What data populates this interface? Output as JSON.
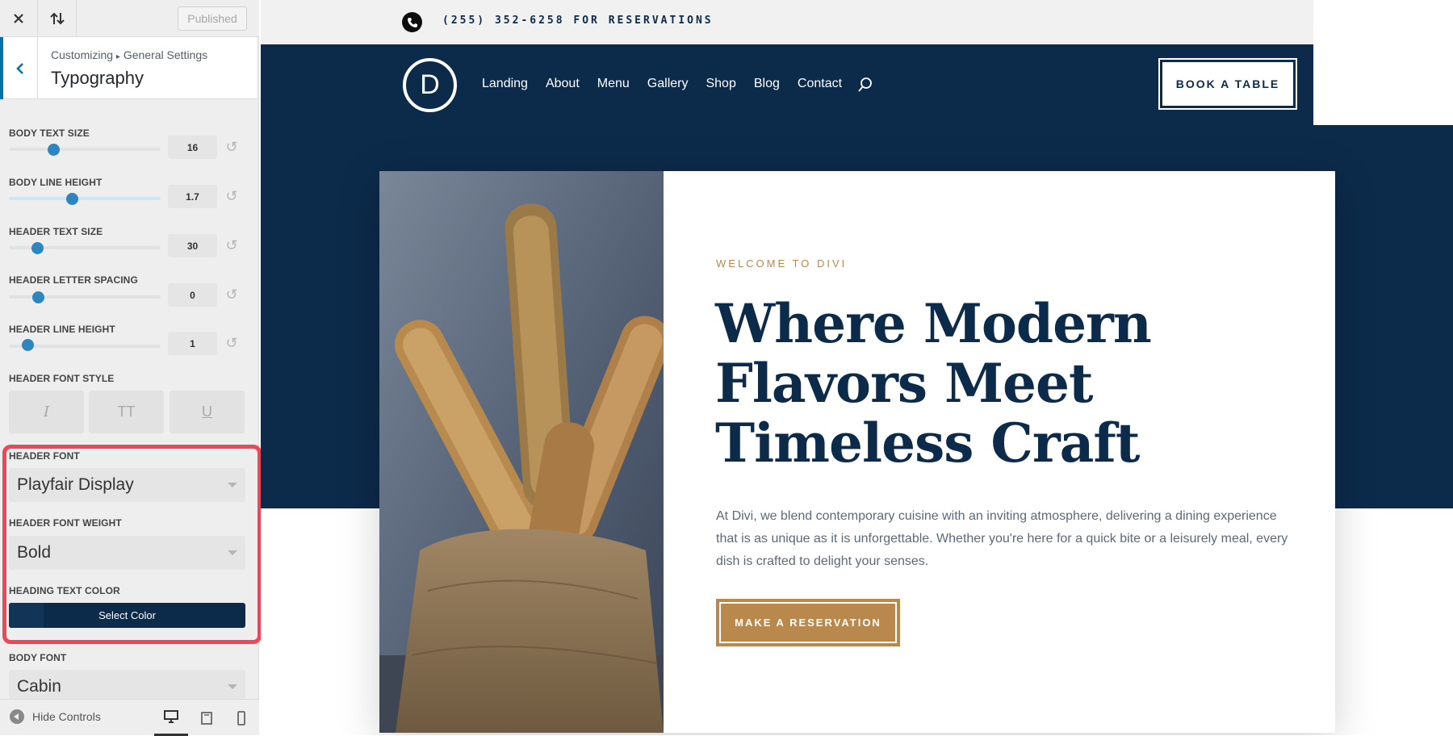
{
  "customizer": {
    "top_bar": {
      "close_icon": "close-icon",
      "sort_icon": "arrows-up-down-icon",
      "published_label": "Published"
    },
    "section": {
      "breadcrumb_root": "Customizing",
      "breadcrumb_parent": "General Settings",
      "title": "Typography"
    },
    "sliders": [
      {
        "label": "BODY TEXT SIZE",
        "value": "16"
      },
      {
        "label": "BODY LINE HEIGHT",
        "value": "1.7"
      },
      {
        "label": "HEADER TEXT SIZE",
        "value": "30"
      },
      {
        "label": "HEADER LETTER SPACING",
        "value": "0"
      },
      {
        "label": "HEADER LINE HEIGHT",
        "value": "1"
      }
    ],
    "header_font_style": {
      "label": "HEADER FONT STYLE",
      "buttons": [
        {
          "name": "italic",
          "glyph": "I"
        },
        {
          "name": "uppercase",
          "glyph": "TT"
        },
        {
          "name": "underline",
          "glyph": "U"
        }
      ]
    },
    "header_font": {
      "label": "HEADER FONT",
      "value": "Playfair Display"
    },
    "header_font_weight": {
      "label": "HEADER FONT WEIGHT",
      "value": "Bold"
    },
    "heading_text_color": {
      "label": "HEADING TEXT COLOR",
      "button_label": "Select Color",
      "color": "#0c2a4a"
    },
    "body_font": {
      "label": "BODY FONT",
      "value": "Cabin"
    },
    "footer": {
      "hide_controls_label": "Hide Controls"
    },
    "highlight_color": "#ef4655"
  },
  "site": {
    "phone_text": "(255) 352-6258 FOR RESERVATIONS",
    "logo_letter": "D",
    "nav": [
      "Landing",
      "About",
      "Menu",
      "Gallery",
      "Shop",
      "Blog",
      "Contact"
    ],
    "book_button": "BOOK A TABLE",
    "hero": {
      "eyebrow": "WELCOME TO DIVI",
      "headline": "Where Modern Flavors Meet Timeless Craft",
      "body": "At Divi, we blend contemporary cuisine with an inviting atmosphere, delivering a dining experience that is as unique as it is unforgettable. Whether you're here for a quick bite or a leisurely meal, every dish is crafted to delight your senses.",
      "cta": "MAKE A RESERVATION"
    },
    "colors": {
      "navy": "#0c2a4a",
      "gold": "#b8884c"
    }
  }
}
